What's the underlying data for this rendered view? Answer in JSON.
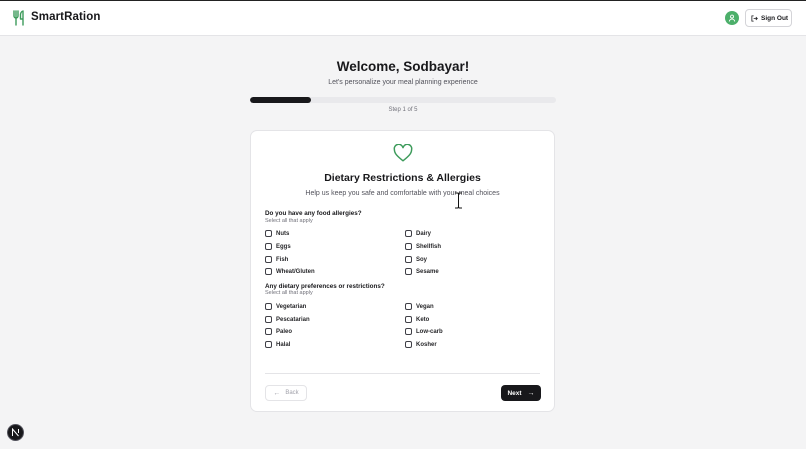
{
  "header": {
    "brand_name": "SmartRation",
    "brand_icon": "utensils-icon",
    "avatar_icon": "user-icon",
    "signout_label": "Sign Out",
    "signout_icon": "log-out-icon"
  },
  "onboarding": {
    "welcome": "Welcome, Sodbayar!",
    "subtitle": "Let's personalize your meal planning experience",
    "progress_fraction": 0.2,
    "step_label": "Step 1 of 5"
  },
  "card": {
    "icon": "heart-icon",
    "title": "Dietary Restrictions & Allergies",
    "description": "Help us keep you safe and comfortable with your meal choices",
    "allergies": {
      "question": "Do you have any food allergies?",
      "hint": "Select all that apply",
      "options": [
        "Nuts",
        "Dairy",
        "Eggs",
        "Shellfish",
        "Fish",
        "Soy",
        "Wheat/Gluten",
        "Sesame"
      ]
    },
    "preferences": {
      "question": "Any dietary preferences or restrictions?",
      "hint": "Select all that apply",
      "options": [
        "Vegetarian",
        "Vegan",
        "Pescatarian",
        "Keto",
        "Paleo",
        "Low-carb",
        "Halal",
        "Kosher"
      ]
    },
    "back_label": "Back",
    "next_label": "Next"
  },
  "colors": {
    "accent_green": "#3d9b5b",
    "primary_dark": "#18181b",
    "background": "#f4f4f5"
  }
}
